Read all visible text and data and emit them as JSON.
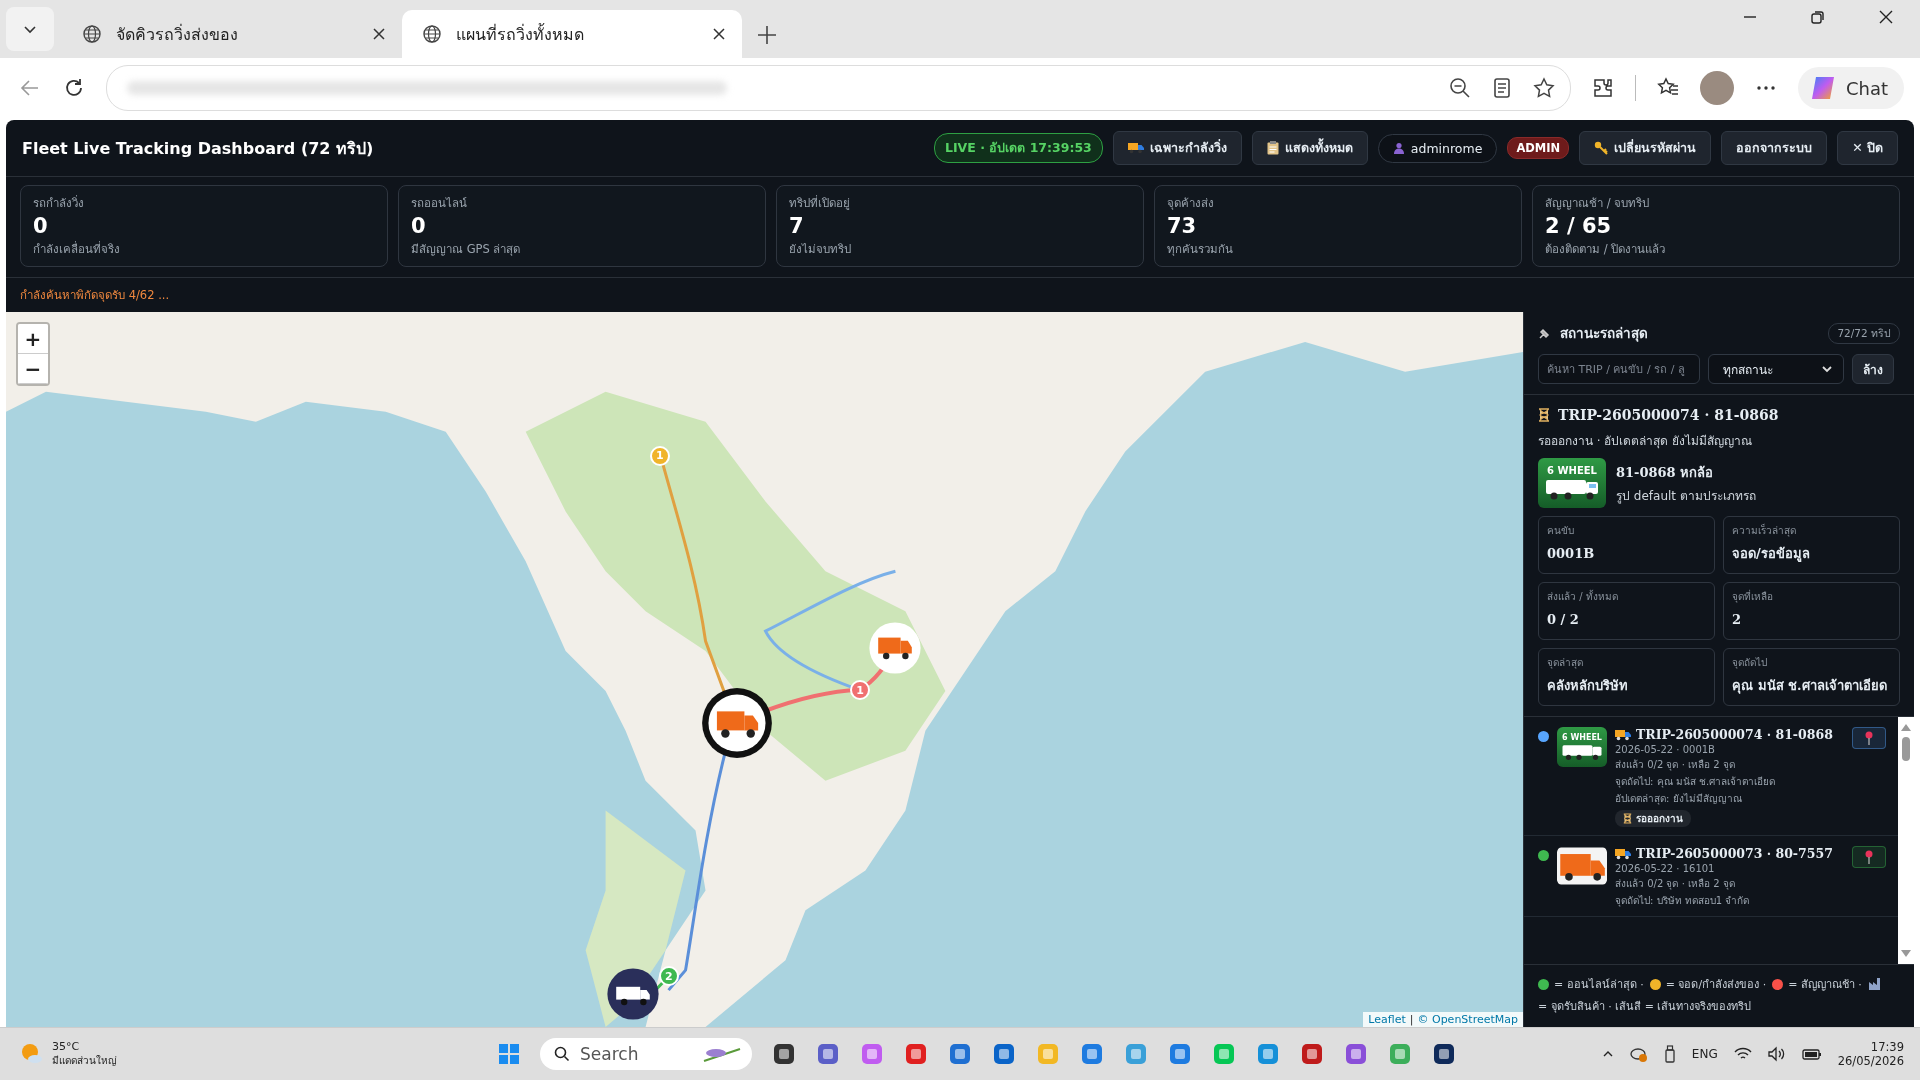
{
  "browser": {
    "tabs": [
      {
        "title": "จัดคิวรถวิ่งส่งของ",
        "selected": false
      },
      {
        "title": "แผนที่รถวิ่งทั้งหมด",
        "selected": true
      }
    ],
    "chat_label": "Chat"
  },
  "header": {
    "title": "Fleet Live Tracking Dashboard (72 ทริป)",
    "live": "LIVE · อัปเดต 17:39:53",
    "buttons": [
      {
        "kind": "truck",
        "label": "เฉพาะกำลังวิ่ง"
      },
      {
        "kind": "clipboard",
        "label": "แสดงทั้งหมด"
      },
      {
        "kind": "user",
        "label": "adminrome"
      },
      {
        "kind": "badge",
        "label": "ADMIN"
      },
      {
        "kind": "key",
        "label": "เปลี่ยนรหัสผ่าน"
      },
      {
        "kind": "plain",
        "label": "ออกจากระบบ"
      },
      {
        "kind": "plain",
        "label": "✕ ปิด"
      }
    ]
  },
  "stats": [
    {
      "label": "รถกำลังวิ่ง",
      "value": "0",
      "sub": "กำลังเคลื่อนที่จริง"
    },
    {
      "label": "รถออนไลน์",
      "value": "0",
      "sub": "มีสัญญาณ GPS ล่าสุด"
    },
    {
      "label": "ทริปที่เปิดอยู่",
      "value": "7",
      "sub": "ยังไม่จบทริป"
    },
    {
      "label": "จุดค้างส่ง",
      "value": "73",
      "sub": "ทุกคันรวมกัน"
    },
    {
      "label": "สัญญาณช้า / จบทริป",
      "value": "2 / 65",
      "sub": "ต้องติดตาม / ปิดงานแล้ว"
    }
  ],
  "status_message": "กำลังค้นหาพิกัดจุดรับ 4/62 ...",
  "map": {
    "zoom_in": "+",
    "zoom_out": "−",
    "markers": [
      {
        "label": "1",
        "color": "#f0b429"
      },
      {
        "label": "1",
        "color": "#f07070"
      },
      {
        "label": "2",
        "color": "#3fb950"
      }
    ],
    "attribution": {
      "leaflet": "Leaflet",
      "separator": "|",
      "osm": "© OpenStreetMap"
    }
  },
  "panel": {
    "title": "สถานะรถล่าสุด",
    "count": "72/72 ทริป",
    "search": {
      "placeholder": "ค้นหา TRIP / คนขับ / รถ / ลู"
    },
    "status_filter": "ทุกสถานะ",
    "clear": "ล้าง",
    "detail": {
      "title": "TRIP-2605000074 · 81-0868",
      "subtitle": "รอออกงาน · อัปเดตล่าสุด ยังไม่มีสัญญาณ",
      "thumb_label": "6 WHEEL",
      "vehicle": "81-0868 หกล้อ",
      "vehicle_note": "รูป default ตามประเภทรถ",
      "fields": [
        {
          "label": "คนขับ",
          "value": "0001B"
        },
        {
          "label": "ความเร็วล่าสุด",
          "value": "จอด/รอข้อมูล"
        },
        {
          "label": "ส่งแล้ว / ทั้งหมด",
          "value": "0 / 2"
        },
        {
          "label": "จุดที่เหลือ",
          "value": "2"
        },
        {
          "label": "จุดล่าสุด",
          "value": "คลังหลักบริษัท"
        },
        {
          "label": "จุดถัดไป",
          "value": "คุณ มนัส ช.ศาลเจ้าตาเอียด"
        }
      ]
    },
    "trips": [
      {
        "color": "#58a6ff",
        "kind": "truck",
        "thumb_label": "6 WHEEL",
        "title": "TRIP-2605000074 · 81-0868",
        "lines": [
          "2026-05-22 · 0001B",
          "ส่งแล้ว 0/2 จุด · เหลือ 2 จุด",
          "จุดถัดไป: คุณ มนัส ช.ศาลเจ้าตาเอียด",
          "อัปเดตล่าสุด: ยังไม่มีสัญญาณ"
        ],
        "status": "รอออกงาน"
      },
      {
        "color": "#3fb950",
        "kind": "van",
        "title": "TRIP-2605000073 · 80-7557",
        "lines": [
          "2026-05-22 · 16101",
          "ส่งแล้ว 0/2 จุด · เหลือ 2 จุด",
          "จุดถัดไป: บริษัท ทดสอบ1 จำกัด"
        ]
      }
    ],
    "legend": [
      {
        "color": "#3fb950",
        "text": "= ออนไลน์ล่าสุด ·"
      },
      {
        "color": "#f0b429",
        "text": "= จอด/กำลังส่งของ ·"
      },
      {
        "color": "#f85149",
        "text": "= สัญญาณช้า ·"
      }
    ],
    "legend_tail": "= จุดรับสินค้า · เส้นสี = เส้นทางจริงของทริป"
  },
  "taskbar": {
    "temperature": "35°C",
    "weather": "มีแดดส่วนใหญ่",
    "search": "Search",
    "language": "ENG",
    "time": "17:39",
    "date": "26/05/2026"
  }
}
